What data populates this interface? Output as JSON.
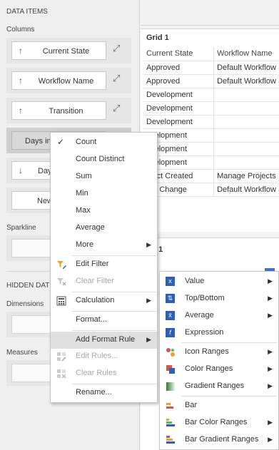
{
  "left_panel": {
    "data_items_header": "DATA ITEMS",
    "columns_header": "Columns",
    "columns": [
      {
        "label": "Current State",
        "arrow": "↑"
      },
      {
        "label": "Workflow Name",
        "arrow": "↑"
      },
      {
        "label": "Transition",
        "arrow": "↑"
      },
      {
        "label": "Days in",
        "arrow": ""
      },
      {
        "label": "Days",
        "arrow": "↓"
      },
      {
        "label": "New",
        "arrow": ""
      }
    ],
    "sparkline_header": "Sparkline",
    "hidden_header": "HIDDEN DAT",
    "dimensions_header": "Dimensions",
    "measures_header": "Measures"
  },
  "grid": {
    "title": "Grid 1",
    "headers": [
      "Current State",
      "Workflow Name"
    ],
    "rows": [
      [
        "Approved",
        "Default Workflow"
      ],
      [
        "Approved",
        "Default Workflow"
      ],
      [
        "Development",
        ""
      ],
      [
        "Development",
        ""
      ],
      [
        "Development",
        ""
      ],
      [
        "evelopment",
        ""
      ],
      [
        "evelopment",
        ""
      ],
      [
        "evelopment",
        ""
      ],
      [
        "oject Created",
        "Manage Projects"
      ],
      [
        "ser Change",
        "Default Workflow"
      ]
    ]
  },
  "chart": {
    "title": "art 1"
  },
  "context_menu": {
    "items": [
      {
        "label": "Count",
        "checked": true
      },
      {
        "label": "Count Distinct"
      },
      {
        "label": "Sum"
      },
      {
        "label": "Min"
      },
      {
        "label": "Max"
      },
      {
        "label": "Average"
      },
      {
        "label": "More",
        "submenu": true
      },
      {
        "label": "Edit Filter"
      },
      {
        "label": "Clear Filter",
        "disabled": true
      },
      {
        "label": "Calculation",
        "submenu": true
      },
      {
        "label": "Format..."
      },
      {
        "label": "Add Format Rule",
        "submenu": true,
        "highlighted": true
      },
      {
        "label": "Edit Rules...",
        "disabled": true
      },
      {
        "label": "Clear Rules",
        "disabled": true
      },
      {
        "label": "Rename..."
      }
    ]
  },
  "format_rule_menu": {
    "items": [
      {
        "label": "Value",
        "submenu": true
      },
      {
        "label": "Top/Bottom",
        "submenu": true
      },
      {
        "label": "Average",
        "submenu": true
      },
      {
        "label": "Expression"
      },
      {
        "label": "Icon Ranges",
        "submenu": true
      },
      {
        "label": "Color Ranges",
        "submenu": true
      },
      {
        "label": "Gradient Ranges",
        "submenu": true
      },
      {
        "label": "Bar"
      },
      {
        "label": "Bar Color Ranges",
        "submenu": true
      },
      {
        "label": "Bar Gradient Ranges",
        "submenu": true
      }
    ]
  },
  "glyphs": {
    "submenu_arrow": "▶",
    "check": "✓",
    "trend": "⤢"
  }
}
